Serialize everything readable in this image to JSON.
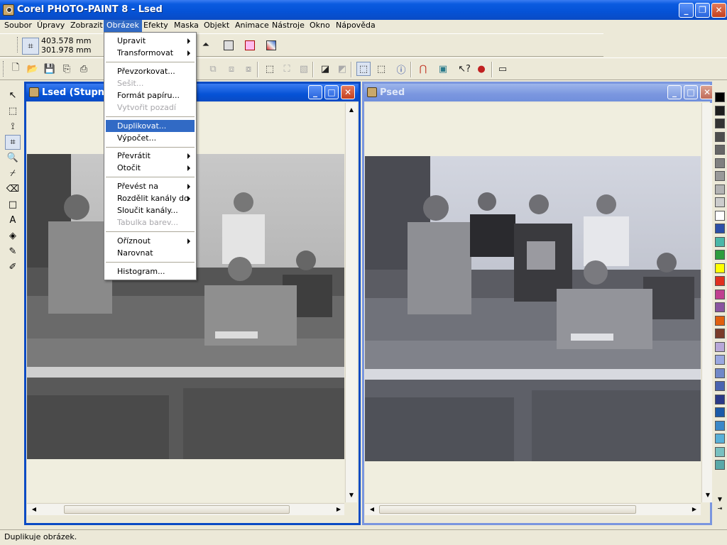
{
  "app": {
    "title": "Corel PHOTO-PAINT 8 - Lsed"
  },
  "menubar": [
    {
      "label": "Soubor"
    },
    {
      "label": "Úpravy"
    },
    {
      "label": "Zobrazit"
    },
    {
      "label": "Obrázek",
      "active": true
    },
    {
      "label": "Efekty"
    },
    {
      "label": "Maska"
    },
    {
      "label": "Objekt"
    },
    {
      "label": "Animace"
    },
    {
      "label": "Nástroje"
    },
    {
      "label": "Okno"
    },
    {
      "label": "Nápověda"
    }
  ],
  "property_bar": {
    "width_value": "403.578 mm",
    "height_value": "301.978 mm"
  },
  "dropdown_menu": {
    "items": [
      {
        "label": "Upravit",
        "submenu": true
      },
      {
        "label": "Transformovat",
        "submenu": true
      },
      {
        "label": "Převzorkovat..."
      },
      {
        "label": "Sešit...",
        "disabled": true
      },
      {
        "label": "Formát papíru..."
      },
      {
        "label": "Vytvořit pozadí",
        "disabled": true
      },
      {
        "label": "Duplikovat...",
        "highlighted": true
      },
      {
        "label": "Výpočet..."
      },
      {
        "label": "Převrátit",
        "submenu": true
      },
      {
        "label": "Otočit",
        "submenu": true
      },
      {
        "label": "Převést na",
        "submenu": true
      },
      {
        "label": "Rozdělit kanály do",
        "submenu": true
      },
      {
        "label": "Sloučit kanály..."
      },
      {
        "label": "Tabulka barev...",
        "disabled": true
      },
      {
        "label": "Oříznout",
        "submenu": true
      },
      {
        "label": "Narovnat"
      },
      {
        "label": "Histogram..."
      }
    ]
  },
  "documents": {
    "left": {
      "title": "Lsed  (Stupně"
    },
    "right": {
      "title": "Psed"
    }
  },
  "palette": {
    "colors": [
      "#000000",
      "#1e1e1e",
      "#333333",
      "#4d4d4d",
      "#666666",
      "#808080",
      "#999999",
      "#b3b3b3",
      "#cccccc",
      "#ffffff",
      "#2b4fa8",
      "#4ab7a8",
      "#2e9c3e",
      "#ffff00",
      "#e03020",
      "#c04090",
      "#8a55a0",
      "#e06010",
      "#7a3c2a",
      "#b8a8d8",
      "#9aa8e0",
      "#7088c8",
      "#4a64b0",
      "#2a3a88",
      "#1a5aa8",
      "#3a88c8",
      "#58b0d8",
      "#78c0c0",
      "#58a8a8"
    ]
  },
  "status": {
    "text": "Duplikuje obrázek."
  }
}
